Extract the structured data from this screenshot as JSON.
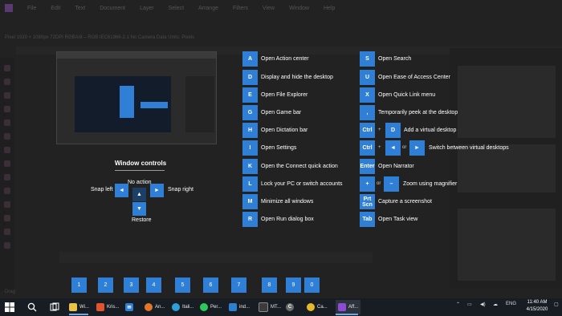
{
  "background_app": {
    "menu": [
      "File",
      "Edit",
      "Text",
      "Document",
      "Layer",
      "Select",
      "Arrange",
      "Filters",
      "View",
      "Window",
      "Help"
    ],
    "context_bar": "Pixel  1920 × 1080px  72DPI  RGBA/8 – RGB IEC61966-2.1  No Camera Data  Units:  Pixels",
    "status": "Drag"
  },
  "window_controls": {
    "title": "Window controls",
    "no_action": "No action",
    "snap_left": "Snap left",
    "snap_right": "Snap right",
    "restore": "Restore"
  },
  "shortcuts_col1": [
    {
      "key": "A",
      "label": "Open Action center"
    },
    {
      "key": "D",
      "label": "Display and hide the desktop"
    },
    {
      "key": "E",
      "label": "Open File Explorer"
    },
    {
      "key": "G",
      "label": "Open Game bar"
    },
    {
      "key": "H",
      "label": "Open Dictation bar"
    },
    {
      "key": "I",
      "label": "Open Settings"
    },
    {
      "key": "K",
      "label": "Open the Connect quick action"
    },
    {
      "key": "L",
      "label": "Lock your PC or switch accounts"
    },
    {
      "key": "M",
      "label": "Minimize all windows"
    },
    {
      "key": "R",
      "label": "Open Run dialog box"
    }
  ],
  "shortcuts_col2": [
    {
      "key": "S",
      "label": "Open Search"
    },
    {
      "key": "U",
      "label": "Open Ease of Access Center"
    },
    {
      "key": "X",
      "label": "Open Quick Link menu"
    },
    {
      "key": ",",
      "label": "Temporarily peek at the desktop"
    },
    {
      "key": "Ctrl",
      "key2": "D",
      "label": "Add a virtual desktop"
    },
    {
      "key": "Ctrl",
      "key2": "◄",
      "or": "or",
      "key3": "►",
      "label": "Switch between virtual desktops"
    },
    {
      "key": "Enter",
      "label": "Open Narrator"
    },
    {
      "key": "+",
      "or": "or",
      "key2": "–",
      "label": "Zoom using magnifier"
    },
    {
      "key": "Prt Scn",
      "label": "Capture a screenshot"
    },
    {
      "key": "Tab",
      "label": "Open Task view"
    }
  ],
  "plus_sign": "+",
  "taskbar": {
    "numbers": [
      "1",
      "2",
      "3",
      "4",
      "5",
      "6",
      "7",
      "8",
      "9",
      "0"
    ],
    "items": [
      {
        "label": "Wi...",
        "icon": "folder-icon",
        "color": "#e8c34a"
      },
      {
        "label": "Kris...",
        "icon": "brave-icon",
        "color": "#e0552f"
      },
      {
        "label": "",
        "icon": "mail-icon",
        "color": "#2f7fd6"
      },
      {
        "label": "An...",
        "icon": "firefox-icon",
        "color": "#e4762b"
      },
      {
        "label": "Itali...",
        "icon": "edge-icon",
        "color": "#2e9fd8"
      },
      {
        "label": "Per...",
        "icon": "spotify-icon",
        "color": "#2ec95a"
      },
      {
        "label": "ind...",
        "icon": "vscode-icon",
        "color": "#2d7fd0"
      },
      {
        "label": "MT...",
        "icon": "terminal-icon",
        "color": "#3c3c3c"
      },
      {
        "label": "",
        "icon": "ccleaner-icon",
        "color": "#6c6c6c"
      },
      {
        "label": "Ca...",
        "icon": "chrome-icon",
        "color": "#e6b92b"
      },
      {
        "label": "Aff...",
        "icon": "affinity-photo-icon",
        "color": "#8e4bd6"
      }
    ],
    "tray_lang": "ENG",
    "time": "11:40 AM",
    "date": "4/15/2020"
  }
}
